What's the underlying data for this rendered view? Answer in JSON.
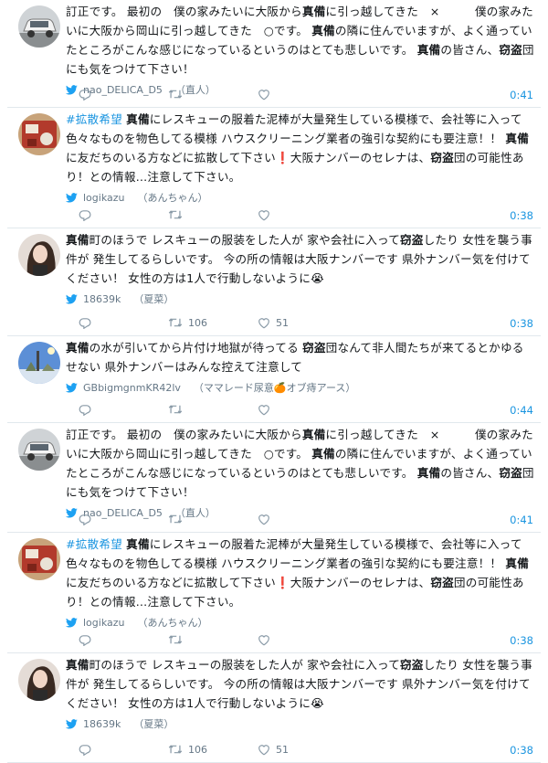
{
  "tweets": [
    {
      "avatar": "car-photo",
      "segments": [
        {
          "t": "訂正です。 最初の　僕の家みたいに大阪から"
        },
        {
          "t": "真備",
          "b": true
        },
        {
          "t": "に引っ越してきた　×　　　僕の家みたいに大阪から岡山に引っ越してきた　○です。 "
        },
        {
          "t": "真備",
          "b": true
        },
        {
          "t": "の隣に住んでいますが、よく通っていたところがこんな感じになっているというのはとても悲しいです。 "
        },
        {
          "t": "真備",
          "b": true
        },
        {
          "t": "の皆さん、"
        },
        {
          "t": "窃盗",
          "b": true
        },
        {
          "t": "団にも気をつけて下さい！"
        }
      ],
      "handle": "nao_DELICA_D5",
      "nick": "（直人）",
      "reply_count": "",
      "retweet_count": "",
      "like_count": "",
      "time": "0:41"
    },
    {
      "avatar": "logikazu-photo",
      "segments": [
        {
          "t": "#拡散希望",
          "h": true
        },
        {
          "t": " "
        },
        {
          "t": "真備",
          "b": true
        },
        {
          "t": "にレスキューの服着た泥棒が大量発生している模様で、会社等に入って色々なものを物色してる模様 ハウスクリーニング業者の強引な契約にも要注意！！ "
        },
        {
          "t": "真備",
          "b": true
        },
        {
          "t": "に友だちのいる方などに拡散して下さい❗️大阪ナンバーのセレナは、"
        },
        {
          "t": "窃盗",
          "b": true
        },
        {
          "t": "団の可能性あり！との情報…注意して下さい。"
        }
      ],
      "handle": "logikazu",
      "nick": "（あんちゃん）",
      "reply_count": "",
      "retweet_count": "",
      "like_count": "",
      "time": "0:38"
    },
    {
      "avatar": "woman-photo",
      "segments": [
        {
          "t": "真備",
          "b": true
        },
        {
          "t": "町のほうで レスキューの服装をした人が 家や会社に入って"
        },
        {
          "t": "窃盗",
          "b": true
        },
        {
          "t": "したり 女性を襲う事件が 発生してるらしいです。 今の所の情報は大阪ナンバーです 県外ナンバー気を付けてください！ 女性の方は1人で行動しないように😭"
        }
      ],
      "handle": "18639k",
      "nick": "（夏菜）",
      "reply_count": "",
      "retweet_count": "106",
      "like_count": "51",
      "time": "0:38"
    },
    {
      "avatar": "landscape-photo",
      "segments": [
        {
          "t": "真備",
          "b": true
        },
        {
          "t": "の水が引いてから片付け地獄が待ってる "
        },
        {
          "t": "窃盗",
          "b": true
        },
        {
          "t": "団なんて非人間たちが来てるとかゆるせない 県外ナンバーはみんな控えて注意して"
        }
      ],
      "handle": "GBbigmgnmKR42lv",
      "nick": "（ママレード尿意🍊オブ痔アース）",
      "reply_count": "",
      "retweet_count": "",
      "like_count": "",
      "time": "0:44"
    },
    {
      "avatar": "car-photo",
      "segments": [
        {
          "t": "訂正です。 最初の　僕の家みたいに大阪から"
        },
        {
          "t": "真備",
          "b": true
        },
        {
          "t": "に引っ越してきた　×　　　僕の家みたいに大阪から岡山に引っ越してきた　○です。 "
        },
        {
          "t": "真備",
          "b": true
        },
        {
          "t": "の隣に住んでいますが、よく通っていたところがこんな感じになっているというのはとても悲しいです。 "
        },
        {
          "t": "真備",
          "b": true
        },
        {
          "t": "の皆さん、"
        },
        {
          "t": "窃盗",
          "b": true
        },
        {
          "t": "団にも気をつけて下さい！"
        }
      ],
      "handle": "nao_DELICA_D5",
      "nick": "（直人）",
      "reply_count": "",
      "retweet_count": "",
      "like_count": "",
      "time": "0:41"
    },
    {
      "avatar": "logikazu-photo",
      "segments": [
        {
          "t": "#拡散希望",
          "h": true
        },
        {
          "t": " "
        },
        {
          "t": "真備",
          "b": true
        },
        {
          "t": "にレスキューの服着た泥棒が大量発生している模様で、会社等に入って色々なものを物色してる模様 ハウスクリーニング業者の強引な契約にも要注意！！ "
        },
        {
          "t": "真備",
          "b": true
        },
        {
          "t": "に友だちのいる方などに拡散して下さい❗️大阪ナンバーのセレナは、"
        },
        {
          "t": "窃盗",
          "b": true
        },
        {
          "t": "団の可能性あり！との情報…注意して下さい。"
        }
      ],
      "handle": "logikazu",
      "nick": "（あんちゃん）",
      "reply_count": "",
      "retweet_count": "",
      "like_count": "",
      "time": "0:38"
    },
    {
      "avatar": "woman-photo",
      "segments": [
        {
          "t": "真備",
          "b": true
        },
        {
          "t": "町のほうで レスキューの服装をした人が 家や会社に入って"
        },
        {
          "t": "窃盗",
          "b": true
        },
        {
          "t": "したり 女性を襲う事件が 発生してるらしいです。 今の所の情報は大阪ナンバーです 県外ナンバー気を付けてください！ 女性の方は1人で行動しないように😭"
        }
      ],
      "handle": "18639k",
      "nick": "（夏菜）",
      "reply_count": "",
      "retweet_count": "106",
      "like_count": "51",
      "time": "0:38"
    }
  ],
  "colors": {
    "link": "#1b95e0",
    "muted": "#657786",
    "divider": "#e1e8ed"
  },
  "icons": {
    "bird": "twitter-bird-icon",
    "reply": "reply-icon",
    "retweet": "retweet-icon",
    "like": "heart-icon"
  }
}
